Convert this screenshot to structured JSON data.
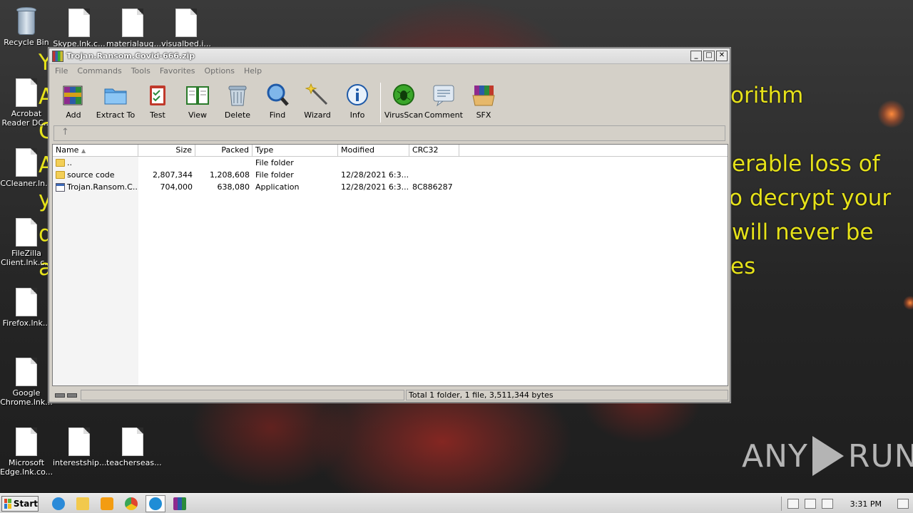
{
  "desktop": {
    "ransom_lines": [
      "orithm",
      "erable loss of",
      "o decrypt your",
      "will never be",
      "es"
    ],
    "ransom_left_letters": [
      "Y",
      "A",
      "C",
      "A",
      "y",
      "d",
      "a"
    ],
    "icons": [
      {
        "id": "recycle-bin",
        "label": "Recycle Bin"
      },
      {
        "id": "skype",
        "label": "Skype.lnk.c..."
      },
      {
        "id": "materialaug",
        "label": "materialaug..."
      },
      {
        "id": "visualbed",
        "label": "visualbed.i..."
      },
      {
        "id": "acrobat",
        "label": "Acrobat Reader DC..."
      },
      {
        "id": "ccleaner",
        "label": "CCleaner.ln..."
      },
      {
        "id": "filezilla",
        "label": "FileZilla Client.lnk.c..."
      },
      {
        "id": "firefox",
        "label": "Firefox.lnk..."
      },
      {
        "id": "chrome",
        "label": "Google Chrome.lnk..."
      },
      {
        "id": "edge",
        "label": "Microsoft Edge.lnk.co..."
      },
      {
        "id": "interestship",
        "label": "interestship..."
      },
      {
        "id": "teacherseas",
        "label": "teacherseas..."
      }
    ],
    "watermark_left": "ANY",
    "watermark_right": "RUN"
  },
  "window": {
    "title": "Trojan.Ransom.Covid-666.zip",
    "buttons": {
      "minimize": "_",
      "maximize": "□",
      "close": "✕"
    },
    "menu": [
      "File",
      "Commands",
      "Tools",
      "Favorites",
      "Options",
      "Help"
    ],
    "toolbar": [
      {
        "label": "Add",
        "icon": "add-archive-icon"
      },
      {
        "label": "Extract To",
        "icon": "extract-folder-icon"
      },
      {
        "label": "Test",
        "icon": "test-clipboard-icon"
      },
      {
        "label": "View",
        "icon": "view-book-icon"
      },
      {
        "label": "Delete",
        "icon": "delete-bin-icon"
      },
      {
        "label": "Find",
        "icon": "find-magnifier-icon"
      },
      {
        "label": "Wizard",
        "icon": "wizard-wand-icon"
      },
      {
        "label": "Info",
        "icon": "info-icon"
      },
      {
        "label": "VirusScan",
        "icon": "virus-scan-icon"
      },
      {
        "label": "Comment",
        "icon": "comment-icon"
      },
      {
        "label": "SFX",
        "icon": "sfx-box-icon"
      }
    ],
    "columns": [
      "Name",
      "Size",
      "Packed",
      "Type",
      "Modified",
      "CRC32"
    ],
    "sort_indicator": "▲",
    "files": [
      {
        "name": "..",
        "size": "",
        "packed": "",
        "type": "File folder",
        "modified": "",
        "crc": "",
        "kind": "folder"
      },
      {
        "name": "source code",
        "size": "2,807,344",
        "packed": "1,208,608",
        "type": "File folder",
        "modified": "12/28/2021 6:3...",
        "crc": "",
        "kind": "folder"
      },
      {
        "name": "Trojan.Ransom.C...",
        "size": "704,000",
        "packed": "638,080",
        "type": "Application",
        "modified": "12/28/2021 6:3...",
        "crc": "8C886287",
        "kind": "app"
      }
    ],
    "status": "Total 1 folder, 1 file, 3,511,344 bytes"
  },
  "taskbar": {
    "start_label": "Start",
    "clock": "3:31 PM",
    "colors": {
      "ie": "#2a8ad8",
      "explorer": "#f2c94c",
      "media": "#f39c12",
      "chrome": "#e0452f",
      "edge": "#1f8dd6",
      "winrar": "#8e44ad"
    }
  }
}
